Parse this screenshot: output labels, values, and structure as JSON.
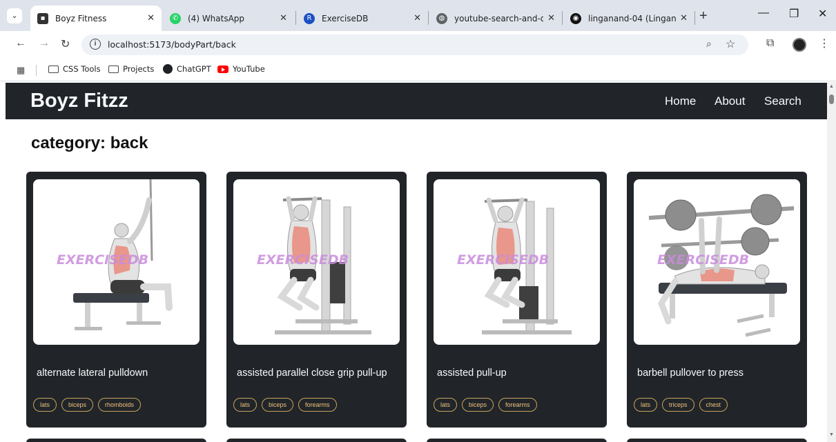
{
  "browser": {
    "tabs": [
      {
        "title": "Boyz Fitness",
        "active": true
      },
      {
        "title": "(4) WhatsApp",
        "active": false
      },
      {
        "title": "ExerciseDB",
        "active": false
      },
      {
        "title": "youtube-search-and-dow",
        "active": false
      },
      {
        "title": "linganand-04 (Linganand",
        "active": false
      }
    ],
    "url": "localhost:5173/bodyPart/back",
    "bookmarks": [
      "CSS Tools",
      "Projects",
      "ChatGPT",
      "YouTube"
    ]
  },
  "site": {
    "brand": "Boyz Fitzz",
    "nav": [
      "Home",
      "About",
      "Search"
    ]
  },
  "category": {
    "label": "category:",
    "value": "back"
  },
  "cards": [
    {
      "title": "alternate lateral pulldown",
      "tags": [
        "lats",
        "biceps",
        "rhomboids"
      ],
      "watermark": "EXERCISEDB"
    },
    {
      "title": "assisted parallel close grip pull-up",
      "tags": [
        "lats",
        "biceps",
        "forearms"
      ],
      "watermark": "EXERCISEDB"
    },
    {
      "title": "assisted pull-up",
      "tags": [
        "lats",
        "biceps",
        "forearms"
      ],
      "watermark": "EXERCISEDB"
    },
    {
      "title": "barbell pullover to press",
      "tags": [
        "lats",
        "triceps",
        "chest"
      ],
      "watermark": "EXERCISEDB"
    }
  ],
  "icons": {
    "tab_menu": "chevron-down-icon",
    "back": "arrow-left-icon",
    "forward": "arrow-right-icon",
    "reload": "reload-icon",
    "site_info": "info-icon",
    "zoom": "zoom-icon",
    "bookmark_star": "star-icon",
    "extensions": "puzzle-icon",
    "profile": "avatar",
    "menu": "kebab-menu-icon"
  },
  "colors": {
    "navbar": "#212529",
    "card": "#212529",
    "tag_border": "#c9a35a",
    "tag_text": "#f1c27d",
    "watermark": "#c98bdc"
  }
}
